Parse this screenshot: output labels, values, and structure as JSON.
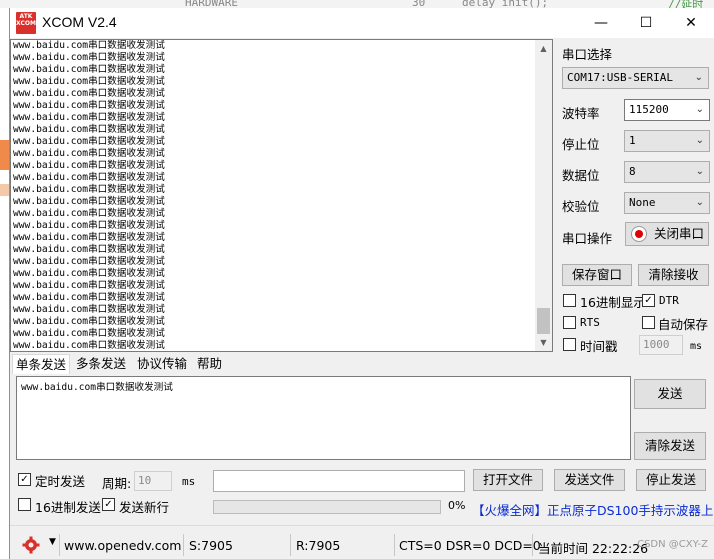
{
  "background": {
    "snippet_left": "HARDWARE",
    "snippet_mid": "30",
    "snippet_right": "delay_init();",
    "snippet_far": "//延时"
  },
  "window": {
    "logo_text_top": "ATK",
    "logo_text_bottom": "XCOM",
    "title": "XCOM V2.4",
    "minimize": "—",
    "maximize": "☐",
    "close": "✕"
  },
  "receive": {
    "lines": [
      "www.baidu.com串口数据收发测试",
      "www.baidu.com串口数据收发测试",
      "www.baidu.com串口数据收发测试",
      "www.baidu.com串口数据收发测试",
      "www.baidu.com串口数据收发测试",
      "www.baidu.com串口数据收发测试",
      "www.baidu.com串口数据收发测试",
      "www.baidu.com串口数据收发测试",
      "www.baidu.com串口数据收发测试",
      "www.baidu.com串口数据收发测试",
      "www.baidu.com串口数据收发测试",
      "www.baidu.com串口数据收发测试",
      "www.baidu.com串口数据收发测试",
      "www.baidu.com串口数据收发测试",
      "www.baidu.com串口数据收发测试",
      "www.baidu.com串口数据收发测试",
      "www.baidu.com串口数据收发测试",
      "www.baidu.com串口数据收发测试",
      "www.baidu.com串口数据收发测试",
      "www.baidu.com串口数据收发测试",
      "www.baidu.com串口数据收发测试",
      "www.baidu.com串口数据收发测试",
      "www.baidu.com串口数据收发测试",
      "www.baidu.com串口数据收发测试",
      "www.baidu.com串口数据收发测试",
      "www.baidu.com串口数据收发测试"
    ],
    "scroll_up": "▲",
    "scroll_down": "▼"
  },
  "serial": {
    "port_label": "串口选择",
    "port_value": "COM17:USB-SERIAL",
    "baud_label": "波特率",
    "baud_value": "115200",
    "stop_label": "停止位",
    "stop_value": "1",
    "data_label": "数据位",
    "data_value": "8",
    "parity_label": "校验位",
    "parity_value": "None",
    "op_label": "串口操作",
    "op_button": "关闭串口",
    "dropdown_arrow": "⌄"
  },
  "receive_controls": {
    "save_window": "保存窗口",
    "clear_receive": "清除接收",
    "hex_display": "16进制显示",
    "hex_display_checked": false,
    "dtr": "DTR",
    "dtr_checked": true,
    "rts": "RTS",
    "rts_checked": false,
    "auto_save": "自动保存",
    "auto_save_checked": false,
    "timestamp": "时间戳",
    "timestamp_checked": false,
    "timestamp_value": "1000",
    "timestamp_unit": "ms"
  },
  "tabs": [
    "单条发送",
    "多条发送",
    "协议传输",
    "帮助"
  ],
  "send": {
    "text": "www.baidu.com串口数据收发测试",
    "send_button": "发送",
    "clear_send": "清除发送",
    "timed_send": "定时发送",
    "timed_send_checked": true,
    "period_label": "周期:",
    "period_value": "10",
    "period_unit": "ms",
    "file_path": "",
    "open_file": "打开文件",
    "send_file": "发送文件",
    "stop_send": "停止发送",
    "hex_send": "16进制发送",
    "hex_send_checked": false,
    "newline": "发送新行",
    "newline_checked": true,
    "progress_text": "0%",
    "progress_fraction": 0.0,
    "ad_text": "【火爆全网】正点原子DS100手持示波器上市"
  },
  "status": {
    "url": "www.openedv.com",
    "sent": "S:7905",
    "received": "R:7905",
    "signals": "CTS=0 DSR=0 DCD=0",
    "time": "当前时间 22:22:26",
    "watermark": "CSDN @CXY-Z"
  },
  "colors": {
    "window_bg": "#f0f0f0",
    "record_red": "#e00000",
    "link_blue": "#0a2bd3",
    "gear_red": "#d9302c"
  }
}
